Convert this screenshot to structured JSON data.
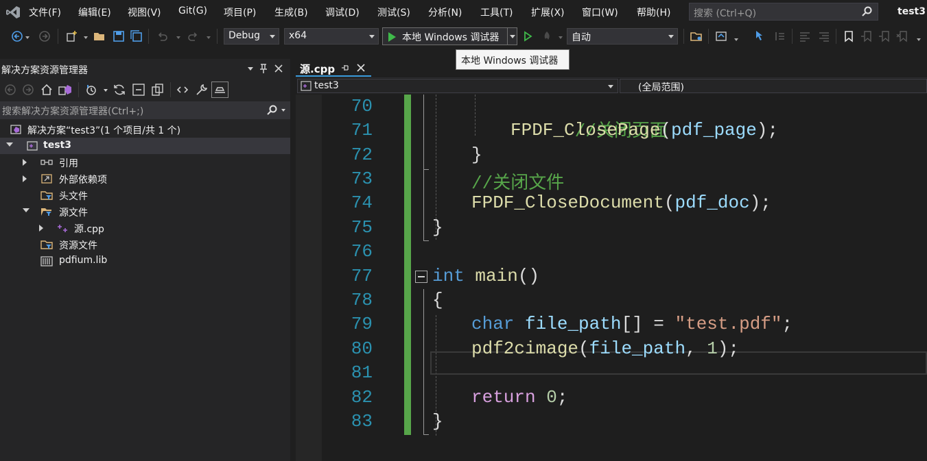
{
  "menu": {
    "items": [
      "文件(F)",
      "编辑(E)",
      "视图(V)",
      "Git(G)",
      "项目(P)",
      "生成(B)",
      "调试(D)",
      "测试(S)",
      "分析(N)",
      "工具(T)",
      "扩展(X)",
      "窗口(W)",
      "帮助(H)"
    ],
    "search_placeholder": "搜索 (Ctrl+Q)",
    "app_title": "test3"
  },
  "toolbar": {
    "configuration": "Debug",
    "platform": "x64",
    "debug_target": "本地 Windows 调试器",
    "start_mode": "自动"
  },
  "tooltip": "本地 Windows 调试器",
  "solution_explorer": {
    "title": "解决方案资源管理器",
    "search_placeholder": "搜索解决方案资源管理器(Ctrl+;)",
    "solution_label": "解决方案“test3”(1 个项目/共 1 个)",
    "project": "test3",
    "nodes": [
      "引用",
      "外部依赖项",
      "头文件",
      "源文件",
      "源.cpp",
      "资源文件",
      "pdfium.lib"
    ]
  },
  "editor": {
    "tab_label": "源.cpp",
    "nav_project": "test3",
    "nav_scope": "(全局范围)",
    "line_numbers": [
      "70",
      "71",
      "72",
      "73",
      "74",
      "75",
      "76",
      "77",
      "78",
      "79",
      "80",
      "81",
      "82",
      "83"
    ],
    "lines": {
      "l70_comment": "//关闭页面",
      "l71_fn": "FPDF_ClosePage",
      "l71_paren_open": "(",
      "l71_arg": "pdf_page",
      "l71_end": ");",
      "l72": "}",
      "l73_comment": "//关闭文件",
      "l74_fn": "FPDF_CloseDocument",
      "l74_paren_open": "(",
      "l74_arg": "pdf_doc",
      "l74_end": ");",
      "l75": "}",
      "l77_kw": "int",
      "l77_fn": "main",
      "l77_parens": "()",
      "l78": "{",
      "l79_kw": "char",
      "l79_var": "file_path",
      "l79_mid": "[] = ",
      "l79_str": "\"test.pdf\"",
      "l79_end": ";",
      "l80_fn": "pdf2cimage",
      "l80_open": "(",
      "l80_arg": "file_path",
      "l80_comma": ", ",
      "l80_num": "1",
      "l80_end": ");",
      "l82_kw": "return",
      "l82_sp": " ",
      "l82_num": "0",
      "l82_end": ";",
      "l83": "}"
    }
  },
  "colors": {
    "background": "#1e1e1e",
    "line_number": "#2b91af",
    "keyword": "#569cd6",
    "function": "#dcdcaa",
    "variable": "#9cdcfe",
    "string": "#d69d85",
    "comment": "#57a64a",
    "change_bar": "#57a64a",
    "play_green": "#3fba4a"
  }
}
